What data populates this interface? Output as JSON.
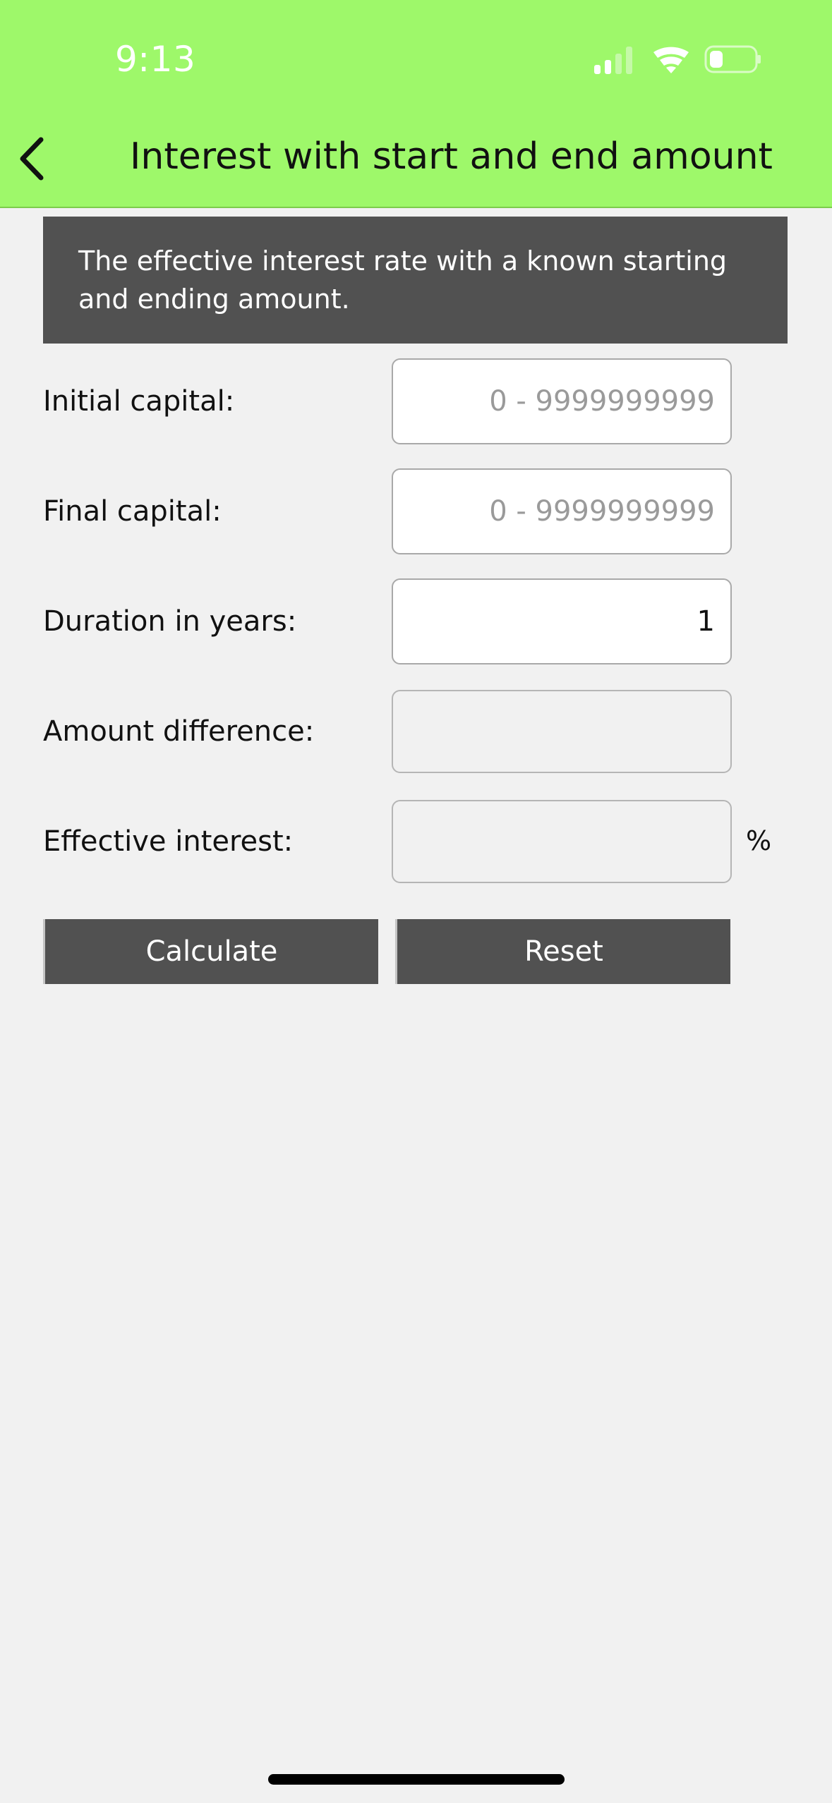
{
  "status_bar": {
    "time": "9:13",
    "icons": [
      "cellular-signal-icon",
      "wifi-icon",
      "battery-icon"
    ]
  },
  "nav": {
    "back_icon": "chevron-left-icon",
    "title": "Interest with start and end amount"
  },
  "info": {
    "text": "The effective interest rate with a known starting and ending amount."
  },
  "form": {
    "initial_capital": {
      "label": "Initial capital:",
      "placeholder": "0 - 9999999999",
      "value": ""
    },
    "final_capital": {
      "label": "Final capital:",
      "placeholder": "0 - 9999999999",
      "value": ""
    },
    "duration": {
      "label": "Duration in years:",
      "value": "1"
    },
    "amount_difference": {
      "label": "Amount difference:",
      "value": ""
    },
    "effective_interest": {
      "label": "Effective interest:",
      "value": "",
      "unit": "%"
    }
  },
  "buttons": {
    "calculate": "Calculate",
    "reset": "Reset"
  },
  "colors": {
    "header_bg": "#9ef86a",
    "panel_bg": "#515151",
    "page_bg": "#f1f1f1"
  }
}
